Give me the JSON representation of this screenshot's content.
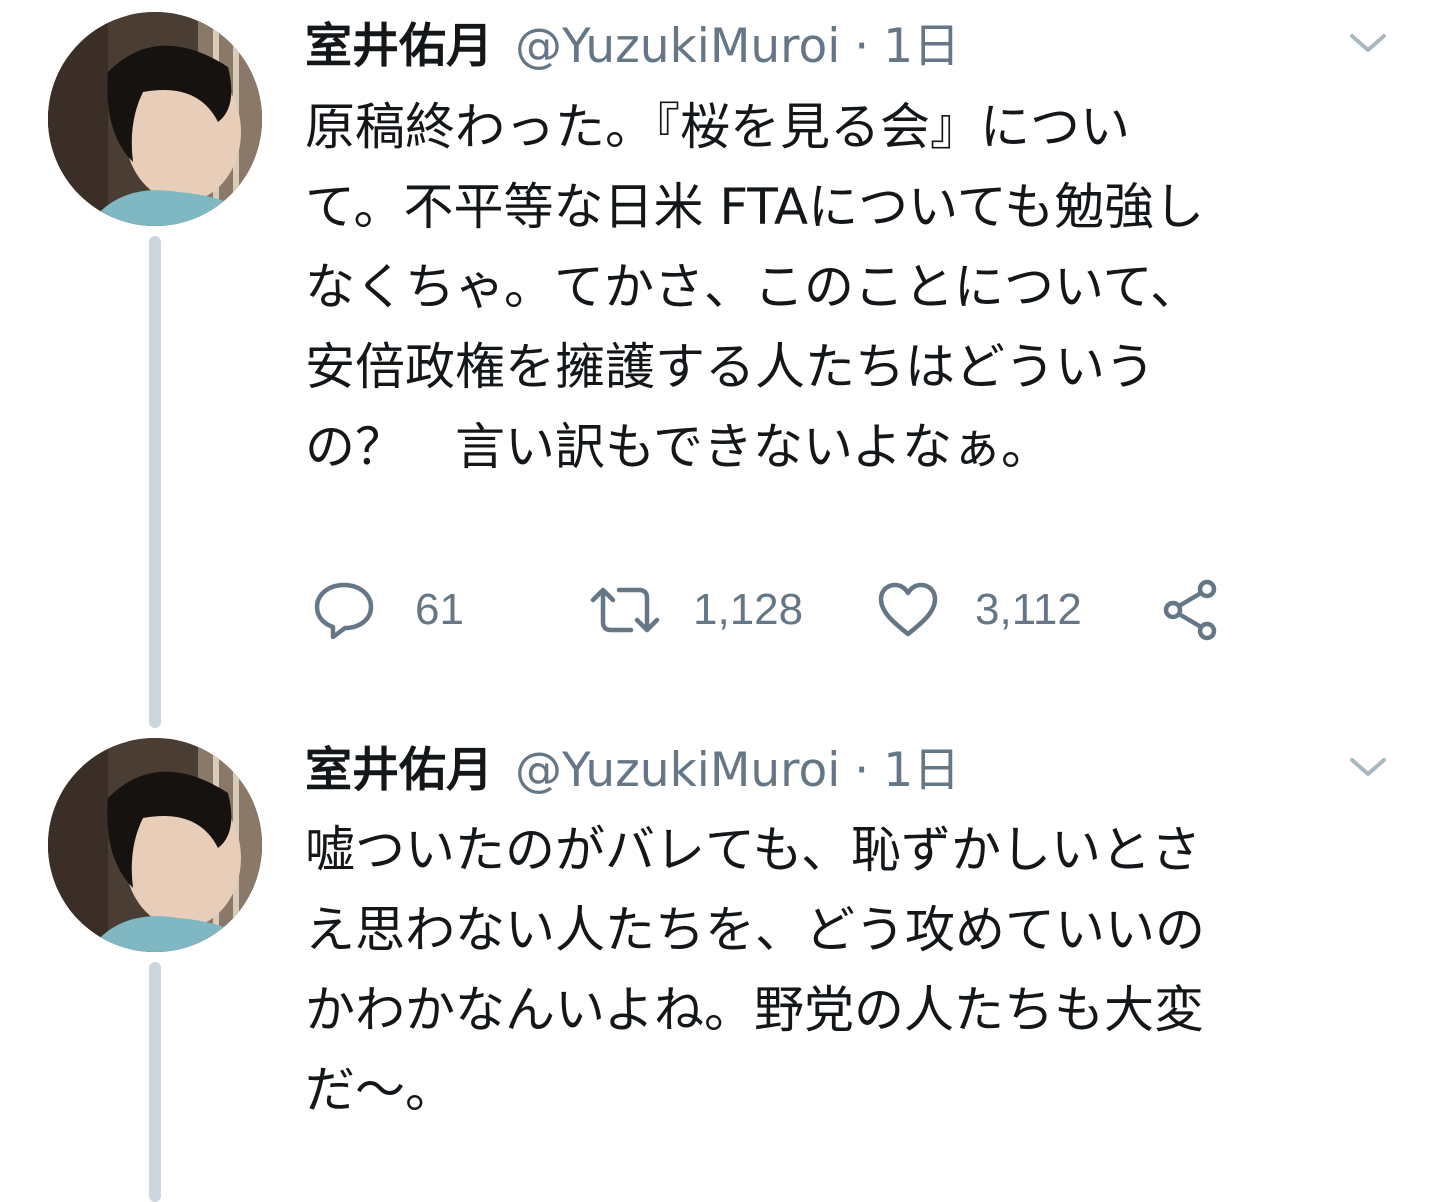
{
  "tweets": [
    {
      "author_name": "室井佑月",
      "handle": "@YuzukiMuroi",
      "separator": "·",
      "time": "1日",
      "lines": [
        "原稿終わった。『桜を見る会』につい",
        "て。不平等な日米 FTAについても勉強し",
        "なくちゃ。てかさ、このことについて、",
        "安倍政権を擁護する人たちはどういう",
        "の？　言い訳もできないよなぁ。"
      ],
      "actions": {
        "reply_count": "61",
        "retweet_count": "1,128",
        "like_count": "3,112"
      }
    },
    {
      "author_name": "室井佑月",
      "handle": "@YuzukiMuroi",
      "separator": "·",
      "time": "1日",
      "lines": [
        "嘘ついたのがバレても、恥ずかしいとさ",
        "え思わない人たちを、どう攻めていいの",
        "かわかなんいよね。野党の人たちも大変",
        "だ〜。"
      ]
    }
  ],
  "colors": {
    "text": "#14171a",
    "secondary": "#657786",
    "thread_line": "#ccd6dd",
    "background": "#ffffff"
  },
  "icons": [
    "reply-icon",
    "retweet-icon",
    "like-icon",
    "share-icon",
    "chevron-down-icon"
  ]
}
